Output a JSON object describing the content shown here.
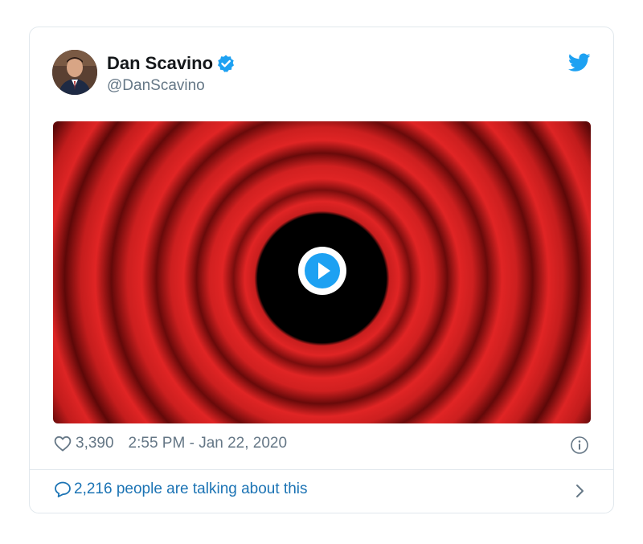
{
  "tweet": {
    "author": {
      "display_name": "Dan Scavino",
      "handle": "@DanScavino",
      "verified": true
    },
    "media": {
      "type": "video",
      "state": "paused"
    },
    "likes": "3,390",
    "timestamp": "2:55 PM - Jan 22, 2020",
    "talking": "2,216 people are talking about this"
  },
  "icons": {
    "verified": "verified-badge-icon",
    "brand": "twitter-bird-icon",
    "like": "heart-outline-icon",
    "info": "info-circle-icon",
    "reply": "speech-bubble-icon",
    "chevron": "chevron-right-icon",
    "play": "play-icon"
  },
  "colors": {
    "brand_blue": "#1da1f2",
    "link_blue": "#1b73b4",
    "text_primary": "#14171a",
    "text_secondary": "#657786",
    "border": "#e1e8ed"
  }
}
